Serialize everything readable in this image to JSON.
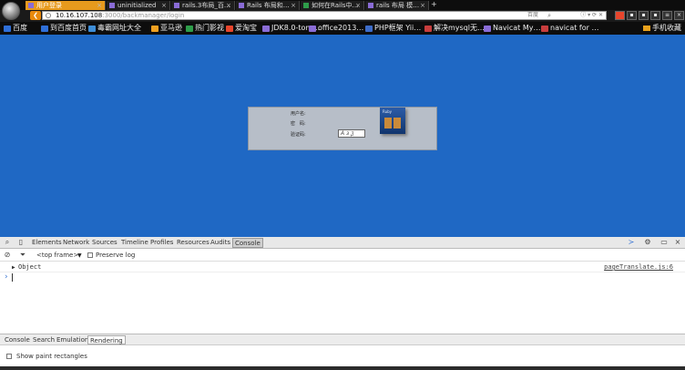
{
  "browser": {
    "tabs": [
      {
        "label": "用户登录",
        "active": true
      },
      {
        "label": "uninitialized",
        "active": false
      },
      {
        "label": "rails.3布局_百…",
        "active": false
      },
      {
        "label": "Rails 布局和…",
        "active": false
      },
      {
        "label": "如何在Rails中…",
        "active": false
      },
      {
        "label": "rails 布局 模…",
        "active": false
      }
    ],
    "new_tab": "+",
    "tab_close": "×",
    "address": {
      "host": "10.16.107.108",
      "path": ":3000/backmanager/login",
      "search_label": "百度",
      "controls": "ⓘ ▾ ⟳ ✕"
    },
    "bookmarks": [
      {
        "label": "百度",
        "color": "#2f6fd8"
      },
      {
        "label": "到百度首页",
        "color": "#2f6fd8"
      },
      {
        "label": "毒霸网址大全",
        "color": "#3e8ed8"
      },
      {
        "label": "亚马逊",
        "color": "#f0a020"
      },
      {
        "label": "热门影视",
        "color": "#2e9d4a"
      },
      {
        "label": "爱淘宝",
        "color": "#e8452c"
      },
      {
        "label": "JDK8.0-tom…",
        "color": "#8a6cd6"
      },
      {
        "label": "office2013…",
        "color": "#8a6cd6"
      },
      {
        "label": "PHP框架 Yii…",
        "color": "#3d6cc8"
      },
      {
        "label": "解决mysql无…",
        "color": "#c83d3d"
      },
      {
        "label": "Navicat My…",
        "color": "#8a6cd6"
      },
      {
        "label": "navicat for …",
        "color": "#c83d3d"
      }
    ],
    "mobile_bookmarks": "手机收藏"
  },
  "page": {
    "login": {
      "username_label": "用户名:",
      "password_label": "密　码:",
      "captcha_label": "验证码:",
      "captcha_text": "A ɜ ᶚ",
      "logo_caption": "Ruby"
    }
  },
  "devtools": {
    "panels": [
      "Elements",
      "Network",
      "Sources",
      "Timeline",
      "Profiles",
      "Resources",
      "Audits",
      "Console"
    ],
    "selected_panel": "Console",
    "frame": "<top frame>",
    "preserve_log": "Preserve log",
    "log_entry": "Object",
    "log_source": "pageTranslate.js:6",
    "prompt": "›",
    "drawer_tabs": [
      "Console",
      "Search",
      "Emulation",
      "Rendering"
    ],
    "selected_drawer_tab": "Rendering",
    "show_paint": "Show paint rectangles"
  },
  "colors": {
    "viewport_bg": "#1f68c4",
    "active_tab": "#e79a1d",
    "login_panel": "#b7bec8"
  }
}
